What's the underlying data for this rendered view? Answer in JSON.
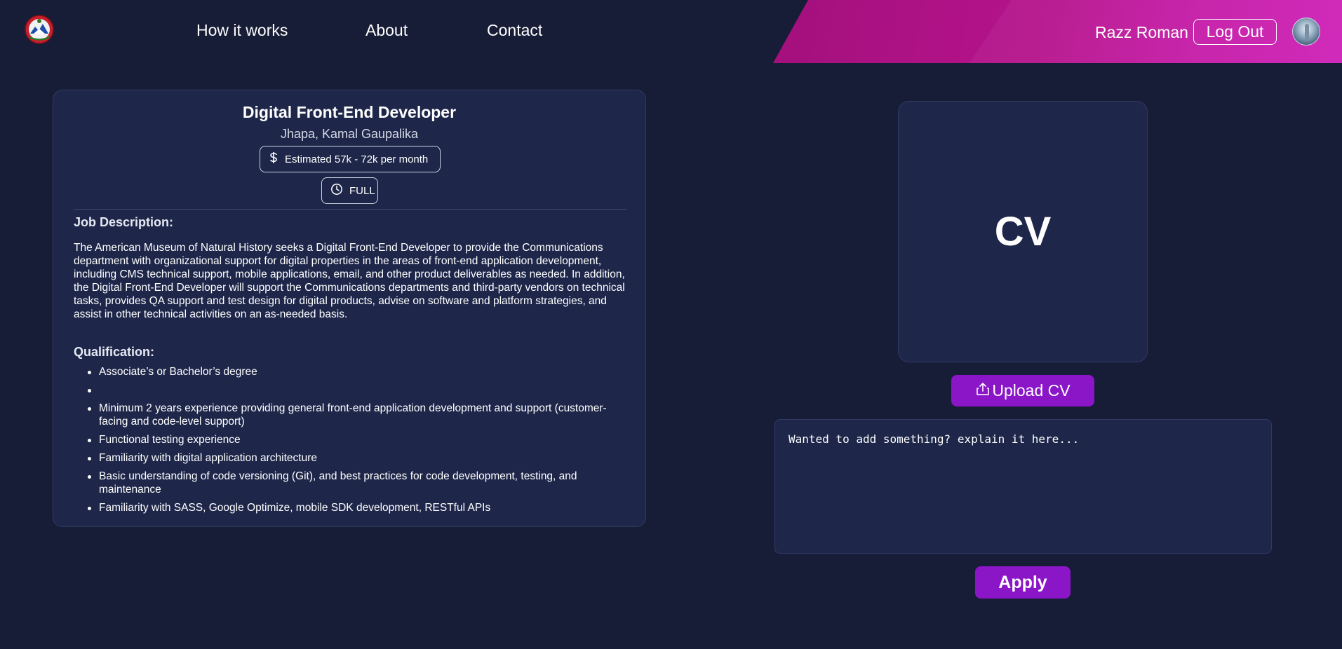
{
  "header": {
    "nav": [
      {
        "label": "How it works"
      },
      {
        "label": "About"
      },
      {
        "label": "Contact"
      }
    ],
    "user_name": "Razz Roman",
    "logout_label": "Log Out",
    "accent_color": "#b5138a"
  },
  "job": {
    "title": "Digital Front-End Developer",
    "location": "Jhapa, Kamal Gaupalika",
    "salary": "Estimated 57k - 72k per month",
    "type": "FULL",
    "description_heading": "Job Description:",
    "description": "The American Museum of Natural History seeks a Digital Front-End Developer to provide the Communications department with organizational support for digital properties in the areas of front-end application development, including CMS technical support, mobile applications, email, and other product deliverables as needed. In addition, the Digital Front-End Developer will support the Communications departments and third-party vendors on technical tasks, provides QA support and test design for digital products, advise on software and platform strategies, and assist in other technical activities on an as-needed basis.",
    "qualification_heading": "Qualification:",
    "qualifications": [
      "Associate’s or Bachelor’s degree",
      "",
      "Minimum 2 years experience providing general front-end application development and support (customer-facing and code-level support)",
      "Functional testing experience",
      "Familiarity with digital application architecture",
      "Basic understanding of code versioning (Git), and best practices for code development, testing, and maintenance",
      "Familiarity with SASS, Google Optimize, mobile SDK development, RESTful APIs"
    ]
  },
  "application": {
    "cv_label": "CV",
    "upload_label": "Upload CV",
    "note_placeholder": "Wanted to add something? explain it here...",
    "apply_label": "Apply",
    "button_color": "#8a16c8"
  },
  "icons": {
    "logo": "nepal-emblem-logo",
    "salary": "dollar-icon",
    "type": "clock-icon",
    "upload": "upload-icon",
    "avatar": "user-avatar"
  }
}
